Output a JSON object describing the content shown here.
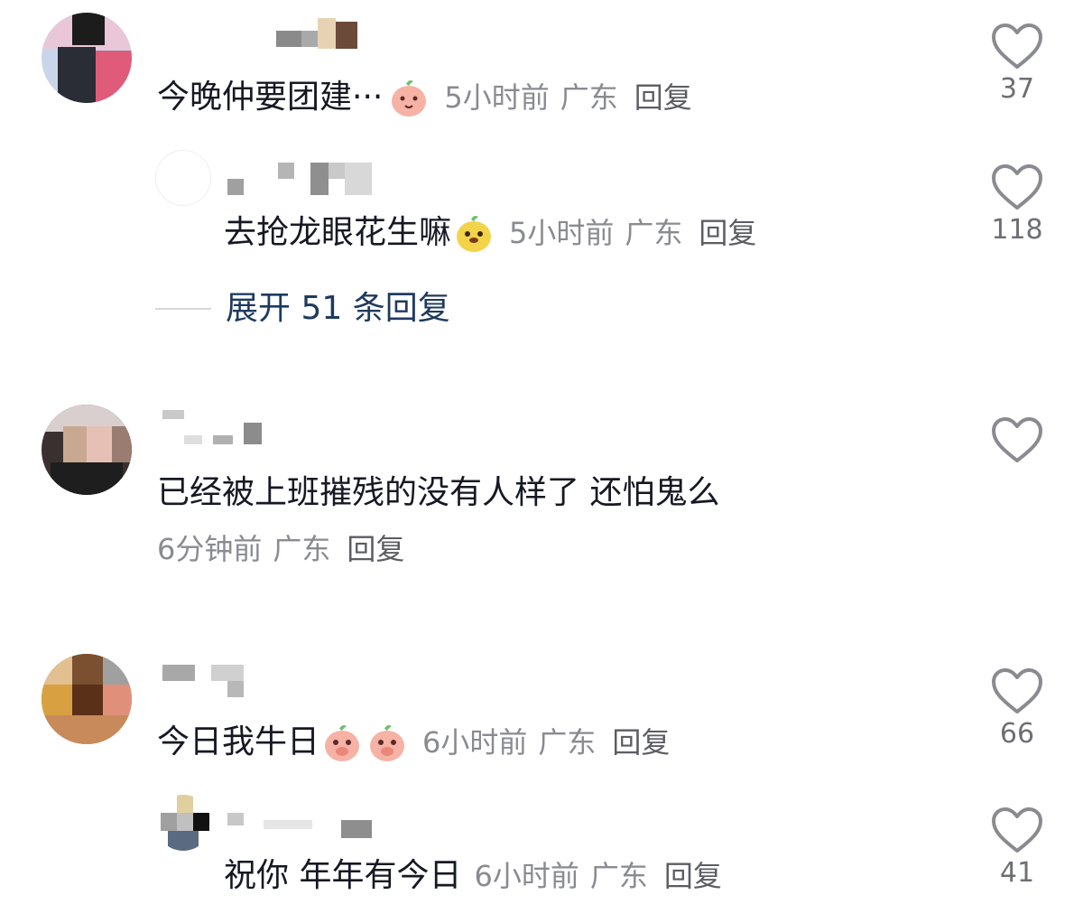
{
  "comments": [
    {
      "text": "今晚仲要团建···",
      "time": "5小时前",
      "location": "广东",
      "reply_label": "回复",
      "likes": "37",
      "reply": {
        "text": "去抢龙眼花生嘛",
        "time": "5小时前",
        "location": "广东",
        "reply_label": "回复",
        "likes": "118"
      },
      "expand_label": "展开 51 条回复"
    },
    {
      "text": "已经被上班摧残的没有人样了 还怕鬼么",
      "time": "6分钟前",
      "location": "广东",
      "reply_label": "回复"
    },
    {
      "text": "今日我牛日",
      "time": "6小时前",
      "location": "广东",
      "reply_label": "回复",
      "likes": "66",
      "reply": {
        "text": "祝你 年年有今日",
        "time": "6小时前",
        "location": "广东",
        "reply_label": "回复",
        "likes": "41"
      }
    }
  ],
  "icons": {
    "like": "heart-outline-icon",
    "emoji_peach": "peach-emoji-icon",
    "emoji_yellow": "yellow-dog-emoji-icon"
  },
  "colors": {
    "text": "#161823",
    "meta": "#8a8b91",
    "expand": "#1e3a5f",
    "heart_stroke": "#8a8b91"
  }
}
